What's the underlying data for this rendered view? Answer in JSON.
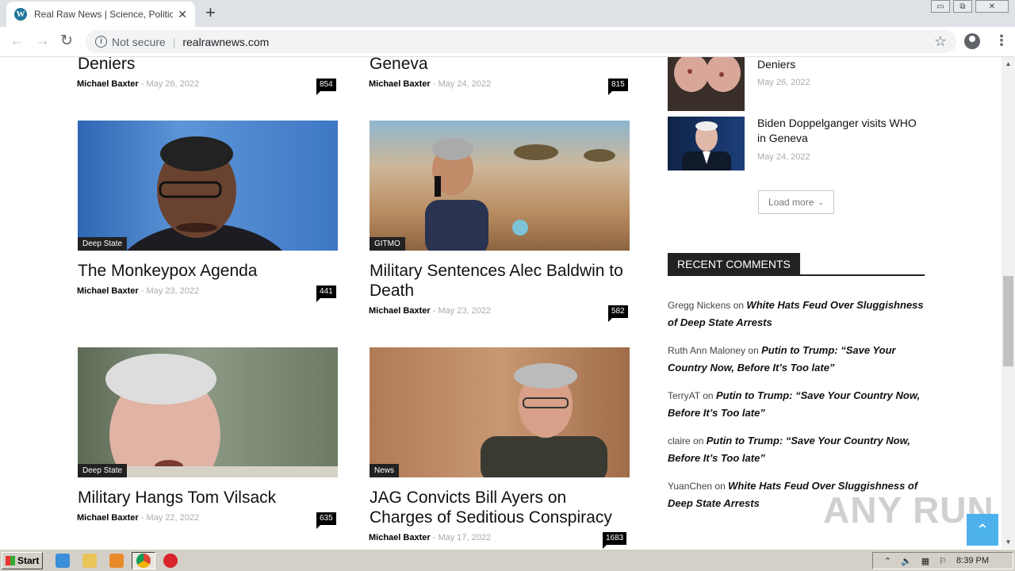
{
  "browser": {
    "tab_title": "Real Raw News | Science, Politics, C",
    "new_tab": "+",
    "not_secure": "Not secure",
    "url": "realrawnews.com",
    "min": "▭",
    "restore": "⧉",
    "close": "✕"
  },
  "posts": [
    {
      "title": "Deniers",
      "author": "Michael Baxter",
      "date": "- May 26, 2022",
      "count": "854"
    },
    {
      "title": "Geneva",
      "author": "Michael Baxter",
      "date": "- May 24, 2022",
      "count": "815"
    },
    {
      "title": "The Monkeypox Agenda",
      "category": "Deep State",
      "author": "Michael Baxter",
      "date": "- May 23, 2022",
      "count": "441"
    },
    {
      "title": "Military Sentences Alec Baldwin to Death",
      "category": "GITMO",
      "author": "Michael Baxter",
      "date": "- May 23, 2022",
      "count": "582"
    },
    {
      "title": "Military Hangs Tom Vilsack",
      "category": "Deep State",
      "author": "Michael Baxter",
      "date": "- May 22, 2022",
      "count": "635"
    },
    {
      "title": "JAG Convicts Bill Ayers on Charges of Seditious Conspiracy",
      "category": "News",
      "author": "Michael Baxter",
      "date": "- May 17, 2022",
      "count": "1683"
    }
  ],
  "sidebar": {
    "items": [
      {
        "title": "Deniers",
        "date": "May 26, 2022"
      },
      {
        "title": "Biden Doppelganger visits WHO in Geneva",
        "date": "May 24, 2022"
      }
    ],
    "load_more": "Load more",
    "recent_comments_heading": "RECENT COMMENTS",
    "on": "on",
    "comments": [
      {
        "author": "Gregg Nickens",
        "post": "White Hats Feud Over Sluggishness of Deep State Arrests"
      },
      {
        "author": "Ruth Ann Maloney",
        "post": "Putin to Trump: “Save Your Country Now, Before It’s Too late”"
      },
      {
        "author": "TerryAT",
        "post": "Putin to Trump: “Save Your Country Now, Before It’s Too late”"
      },
      {
        "author": "claire",
        "post": "Putin to Trump: “Save Your Country Now, Before It’s Too late”"
      },
      {
        "author": "YuanChen",
        "post": "White Hats Feud Over Sluggishness of Deep State Arrests"
      }
    ]
  },
  "watermark": "ANY RUN",
  "taskbar": {
    "start": "Start",
    "clock": "8:39 PM"
  },
  "colors": {
    "accent": "#4db2ec",
    "badge": "#000000"
  }
}
